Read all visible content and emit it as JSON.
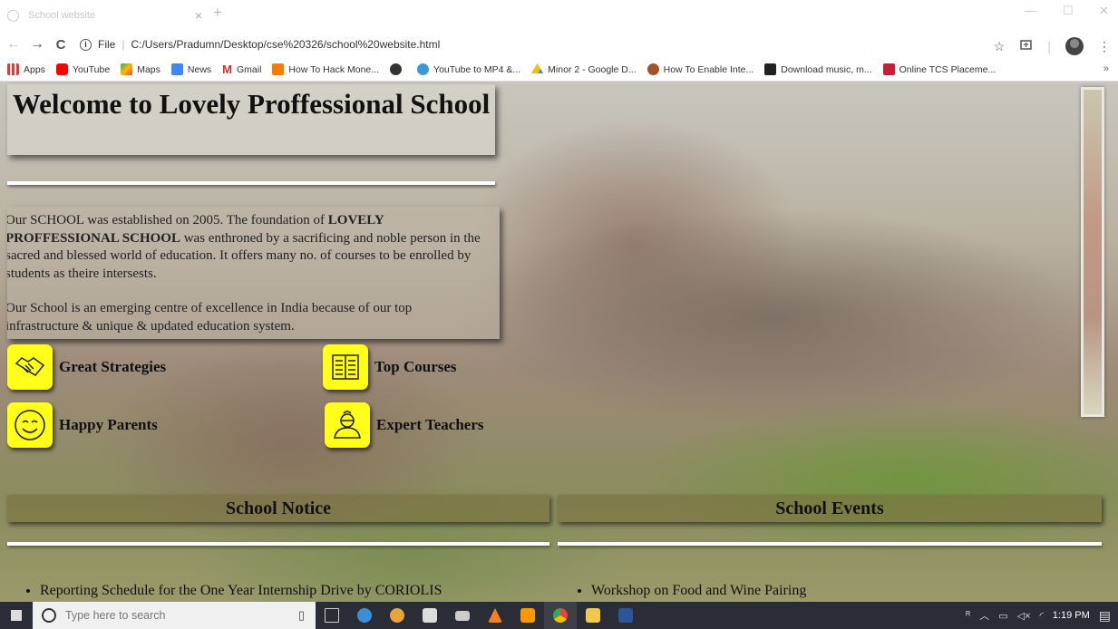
{
  "browser": {
    "tab_title": "School website",
    "tab_close": "×",
    "new_tab": "+",
    "minimize": "—",
    "maximize": "☐",
    "close": "✕",
    "back": "←",
    "forward": "→",
    "reload": "C",
    "url_prefix": "File",
    "url": "C:/Users/Pradumn/Desktop/cse%20326/school%20website.html",
    "star": "☆",
    "menu": "⋮",
    "bookmarks_more": "»"
  },
  "bookmarks": [
    {
      "label": "Apps",
      "icon": "apps-grid-icon",
      "color": "#e33"
    },
    {
      "label": "YouTube",
      "icon": "youtube-icon",
      "color": "#ff0000"
    },
    {
      "label": "Maps",
      "icon": "maps-icon",
      "color": "#34a853"
    },
    {
      "label": "News",
      "icon": "google-news-icon",
      "color": "#4285f4"
    },
    {
      "label": "Gmail",
      "icon": "gmail-icon",
      "color": "#d93025"
    },
    {
      "label": "How To Hack Mone...",
      "icon": "blogger-icon",
      "color": "#f57d00"
    },
    {
      "label": "",
      "icon": "circle-dark-icon",
      "color": "#333333"
    },
    {
      "label": "YouTube to MP4 &...",
      "icon": "converter-icon",
      "color": "#3a9ad9"
    },
    {
      "label": "Minor 2 - Google D...",
      "icon": "google-drive-icon",
      "color": "#fbbc04"
    },
    {
      "label": "How To Enable Inte...",
      "icon": "mascot-icon",
      "color": "#a0522d"
    },
    {
      "label": "Download music, m...",
      "icon": "download-icon",
      "color": "#222222"
    },
    {
      "label": "Online TCS Placeme...",
      "icon": "tcs-icon",
      "color": "#c41e3a"
    }
  ],
  "page": {
    "title": "Welcome to Lovely Proffessional School",
    "about": {
      "p1_a": "Our SCHOOL was established on 2005. The foundation of ",
      "p1_bold": "LOVELY PROFFESSIONAL SCHOOL",
      "p1_b": " was enthroned by a sacrificing and noble person in the sacred and blessed world of education. It offers many no. of courses to be enrolled by students as theire intersests.",
      "p2": "Our School is an emerging centre of excellence in India because of our top infrastructure & unique & updated education system."
    },
    "features": [
      {
        "label": "Great Strategies",
        "icon": "handshake-icon"
      },
      {
        "label": "Top Courses",
        "icon": "open-book-icon"
      },
      {
        "label": "Happy Parents",
        "icon": "smiley-icon"
      },
      {
        "label": "Expert Teachers",
        "icon": "teacher-icon"
      }
    ],
    "notice": {
      "heading": "School Notice",
      "items": [
        "Reporting Schedule for the One Year Internship Drive by CORIOLIS"
      ]
    },
    "events": {
      "heading": "School Events",
      "items": [
        "Workshop on Food and Wine Pairing"
      ]
    },
    "accent_yellow": "#ffff1a"
  },
  "taskbar": {
    "search_placeholder": "Type here to search",
    "time": "1:19 PM",
    "date": ""
  }
}
